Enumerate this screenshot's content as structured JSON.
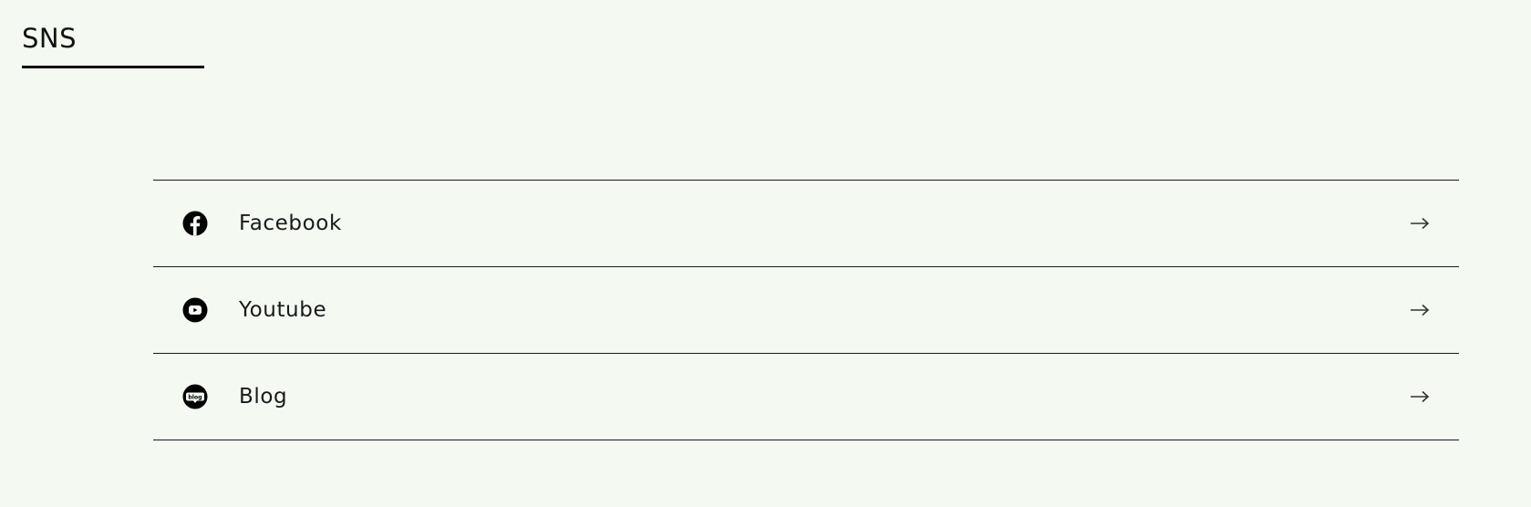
{
  "section": {
    "title": "SNS"
  },
  "links": [
    {
      "label": "Facebook",
      "icon": "facebook-icon"
    },
    {
      "label": "Youtube",
      "icon": "youtube-icon"
    },
    {
      "label": "Blog",
      "icon": "blog-icon",
      "icon_text": "blog"
    }
  ],
  "colors": {
    "background": "#f4f9f2",
    "text": "#111111",
    "divider": "#1a1a1a"
  }
}
